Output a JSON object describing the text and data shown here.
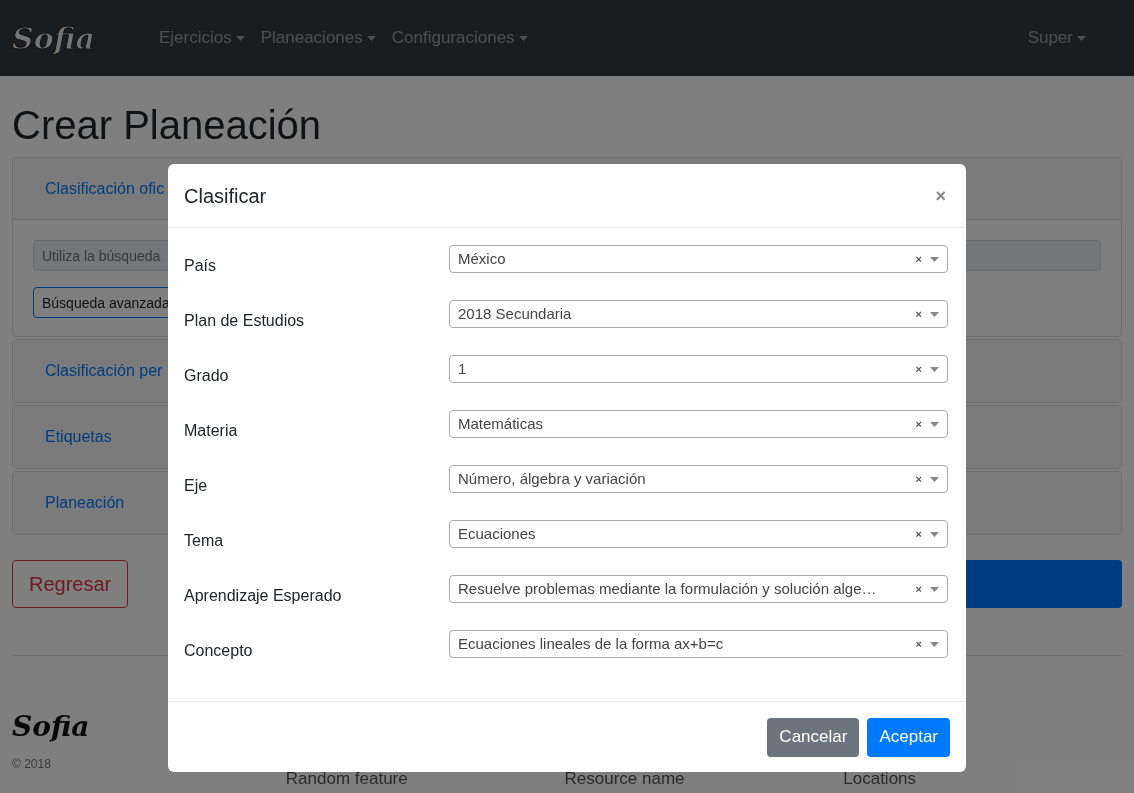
{
  "navbar": {
    "logo": "Sofia",
    "items": [
      {
        "label": "Ejercicios"
      },
      {
        "label": "Planeaciones"
      },
      {
        "label": "Configuraciones"
      }
    ],
    "user": "Super"
  },
  "page": {
    "title": "Crear Planeación",
    "cards": [
      {
        "title": "Clasificación ofic",
        "expanded": true,
        "search_placeholder": "Utiliza la búsqueda",
        "search_button": "Búsqueda avanzada"
      },
      {
        "title": "Clasificación per",
        "expanded": false
      },
      {
        "title": "Etiquetas",
        "expanded": false
      },
      {
        "title": "Planeación",
        "expanded": false
      }
    ],
    "back_button": "Regresar"
  },
  "footer": {
    "logo": "Sofia",
    "copyright": "© 2018",
    "columns": [
      "Random feature",
      "Resource name",
      "Locations"
    ]
  },
  "modal": {
    "title": "Clasificar",
    "close": "×",
    "fields": [
      {
        "label": "País",
        "value": "México",
        "clear": "×"
      },
      {
        "label": "Plan de Estudios",
        "value": "2018 Secundaria",
        "clear": "×"
      },
      {
        "label": "Grado",
        "value": "1",
        "clear": "×"
      },
      {
        "label": "Materia",
        "value": "Matemáticas",
        "clear": "×"
      },
      {
        "label": "Eje",
        "value": "Número, álgebra y variación",
        "clear": "×"
      },
      {
        "label": "Tema",
        "value": "Ecuaciones",
        "clear": "×"
      },
      {
        "label": "Aprendizaje Esperado",
        "value": "Resuelve problemas mediante la formulación y solución alge…",
        "clear": "×"
      },
      {
        "label": "Concepto",
        "value": "Ecuaciones lineales de la forma ax+b=c",
        "clear": "×"
      }
    ],
    "buttons": [
      {
        "label": "Cancelar",
        "kind": "secondary"
      },
      {
        "label": "Aceptar",
        "kind": "primary"
      }
    ]
  }
}
